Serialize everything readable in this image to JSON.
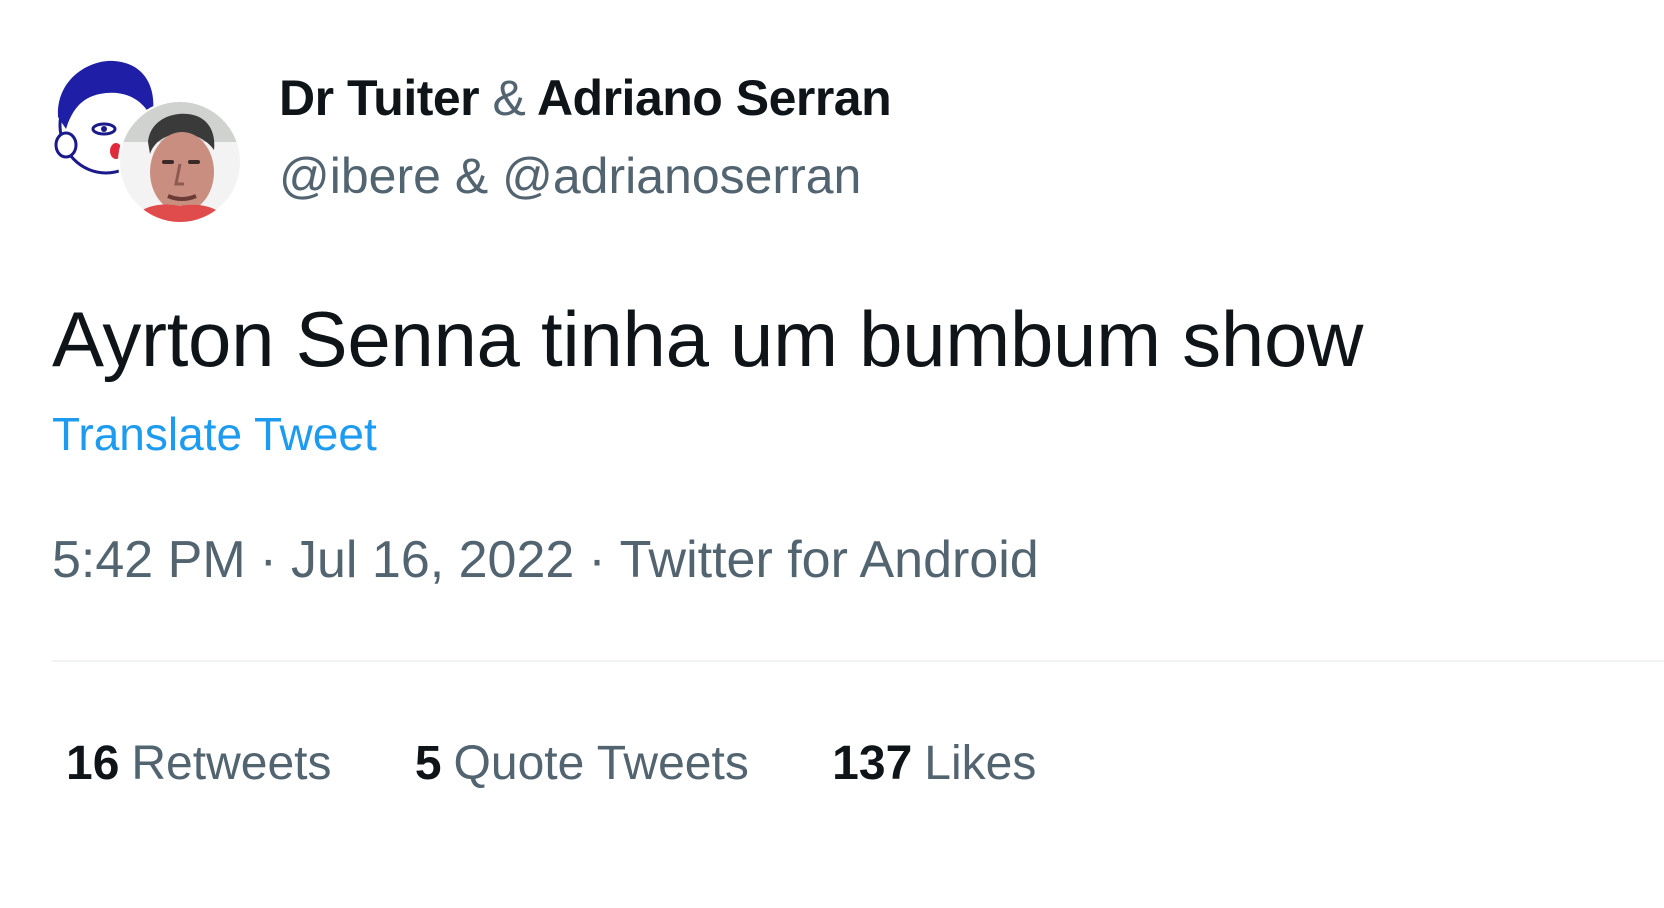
{
  "author": {
    "name_primary": "Dr Tuiter",
    "name_joiner": "&",
    "name_secondary": "Adriano Serran",
    "handles": "@ibere & @adrianoserran",
    "avatar_primary_icon": "cartoon-face-avatar",
    "avatar_secondary_icon": "man-photo-avatar"
  },
  "tweet": {
    "text": "Ayrton Senna tinha um bumbum show",
    "translate_label": "Translate Tweet"
  },
  "meta": {
    "time": "5:42 PM",
    "separator": "·",
    "date": "Jul 16, 2022",
    "source": "Twitter for Android"
  },
  "stats": {
    "retweets_count": "16",
    "retweets_label": "Retweets",
    "quotes_count": "5",
    "quotes_label": "Quote Tweets",
    "likes_count": "137",
    "likes_label": "Likes"
  },
  "colors": {
    "text_primary": "#0f1419",
    "text_secondary": "#536471",
    "link": "#1d9bf0",
    "divider": "#eff3f4"
  }
}
